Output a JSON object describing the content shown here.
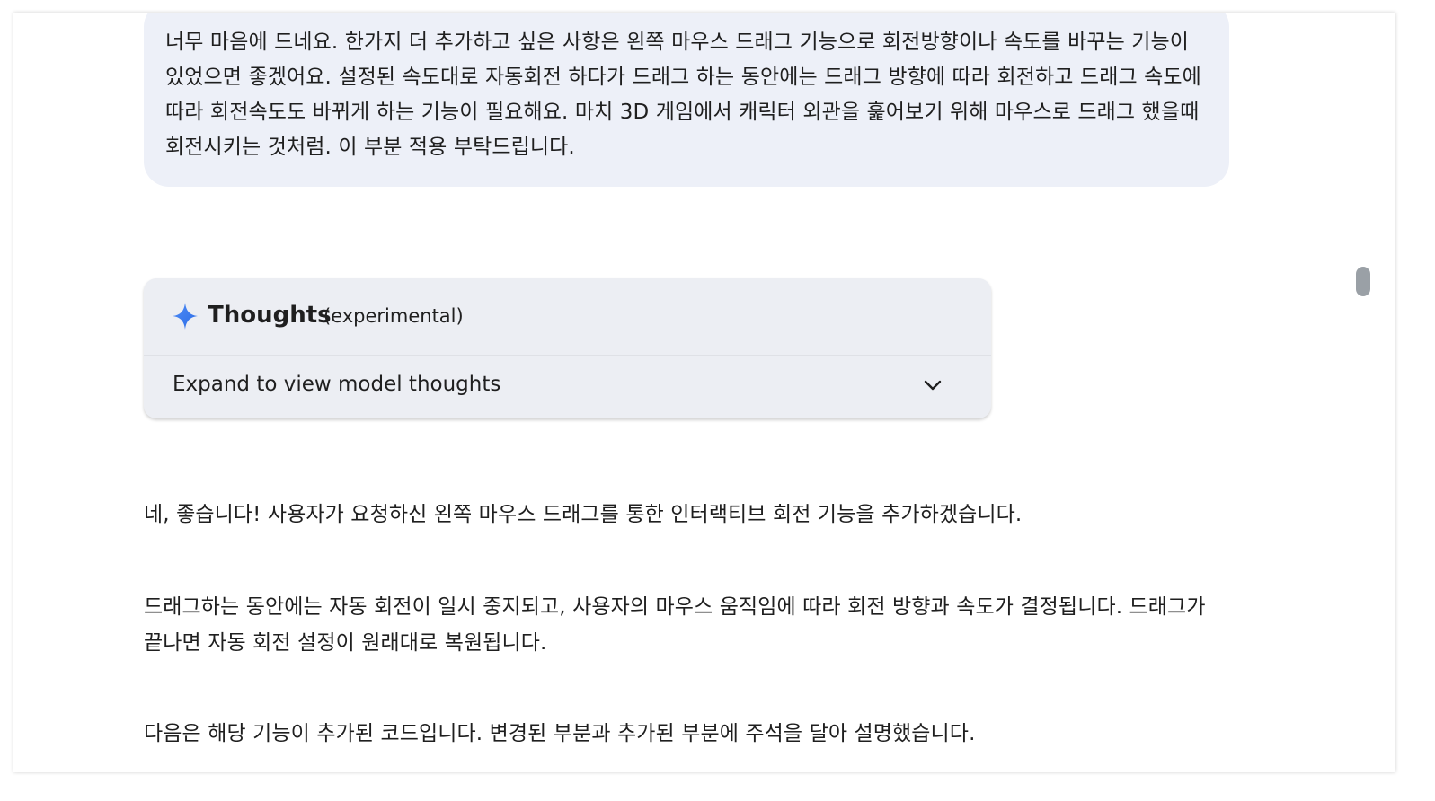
{
  "conversation": {
    "user_message": "너무 마음에 드네요. 한가지 더 추가하고 싶은 사항은 왼쪽 마우스 드래그 기능으로 회전방향이나 속도를 바꾸는 기능이 있었으면 좋겠어요. 설정된 속도대로 자동회전 하다가 드래그 하는 동안에는 드래그 방향에 따라 회전하고 드래그 속도에 따라 회전속도도 바뀌게 하는 기능이 필요해요. 마치 3D 게임에서 캐릭터 외관을 훑어보기 위해 마우스로 드래그 했을때 회전시키는 것처럼. 이 부분 적용 부탁드립니다.",
    "thoughts": {
      "title": "Thoughts",
      "subtitle": "(experimental)",
      "expand_label": "Expand to view model thoughts",
      "icon": "sparkle-icon",
      "icon_color": "#4285f4"
    },
    "response_paragraphs": [
      "네, 좋습니다! 사용자가 요청하신 왼쪽 마우스 드래그를 통한 인터랙티브 회전 기능을 추가하겠습니다.",
      "드래그하는 동안에는 자동 회전이 일시 중지되고, 사용자의 마우스 움직임에 따라 회전 방향과 속도가 결정됩니다. 드래그가 끝나면 자동 회전 설정이 원래대로 복원됩니다.",
      "다음은 해당 기능이 추가된 코드입니다. 변경된 부분과 추가된 부분에 주석을 달아 설명했습니다."
    ]
  },
  "colors": {
    "user_bubble_bg": "#edf0f8",
    "thoughts_card_bg": "#eceef3",
    "text": "#1f1f1f"
  }
}
